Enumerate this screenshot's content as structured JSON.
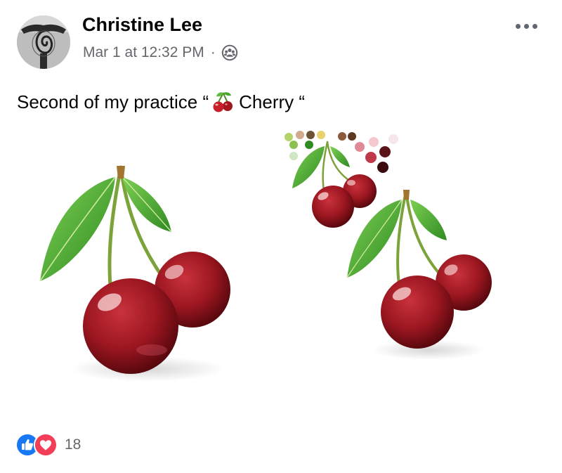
{
  "post": {
    "author": "Christine Lee",
    "date": "Mar 1 at 12:32 PM",
    "separator": "·",
    "audience_icon": "friends-icon",
    "text_before": "Second of my practice “",
    "emoji": "cherry-emoji",
    "text_after": " Cherry “",
    "image_description": "drawing of cherries"
  },
  "reactions": {
    "icons": [
      "like-icon",
      "love-icon"
    ],
    "count": "18"
  },
  "colors": {
    "like_blue": "#1877f2",
    "love_red": "#f33e58",
    "secondary_text": "#65676b",
    "cherry_red": "#9b1620",
    "leaf_green": "#4caf3c"
  }
}
